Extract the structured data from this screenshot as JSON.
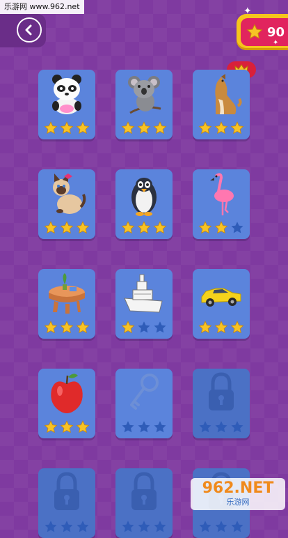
{
  "watermark": {
    "top_text": "乐游网 www.962.net",
    "bottom_big": "962.NET",
    "bottom_small": "乐游网"
  },
  "header": {
    "star_count": "90",
    "back_icon": "chevron-left-icon",
    "star_icon": "star-icon"
  },
  "colors": {
    "background": "#7f3aa0",
    "card": "#5b84dc",
    "card_locked": "#4b71c5",
    "star_filled": "#f7c325",
    "star_empty": "#2f5cb8",
    "coin_bg": "#e1245e"
  },
  "levels": [
    {
      "id": "panda",
      "art": "panda-icon",
      "stars": 3,
      "locked": false
    },
    {
      "id": "koala",
      "art": "koala-icon",
      "stars": 3,
      "locked": false
    },
    {
      "id": "dog",
      "art": "dog-icon",
      "stars": 3,
      "locked": false,
      "badge": "crown-icon"
    },
    {
      "id": "cat",
      "art": "cat-icon",
      "stars": 3,
      "locked": false
    },
    {
      "id": "penguin",
      "art": "penguin-icon",
      "stars": 3,
      "locked": false
    },
    {
      "id": "flamingo",
      "art": "flamingo-icon",
      "stars": 2,
      "locked": false
    },
    {
      "id": "table",
      "art": "table-icon",
      "stars": 3,
      "locked": false
    },
    {
      "id": "boat",
      "art": "boat-icon",
      "stars": 1,
      "locked": false
    },
    {
      "id": "car",
      "art": "car-icon",
      "stars": 3,
      "locked": false
    },
    {
      "id": "apple",
      "art": "apple-icon",
      "stars": 3,
      "locked": false
    },
    {
      "id": "key",
      "art": "key-icon",
      "stars": 0,
      "locked": false
    },
    {
      "id": "locked-12",
      "art": "lock-icon",
      "stars": 0,
      "locked": true
    },
    {
      "id": "locked-13",
      "art": "lock-icon",
      "stars": 0,
      "locked": true
    },
    {
      "id": "locked-14",
      "art": "lock-icon",
      "stars": 0,
      "locked": true
    },
    {
      "id": "locked-15",
      "art": "lock-icon",
      "stars": 0,
      "locked": true
    }
  ]
}
